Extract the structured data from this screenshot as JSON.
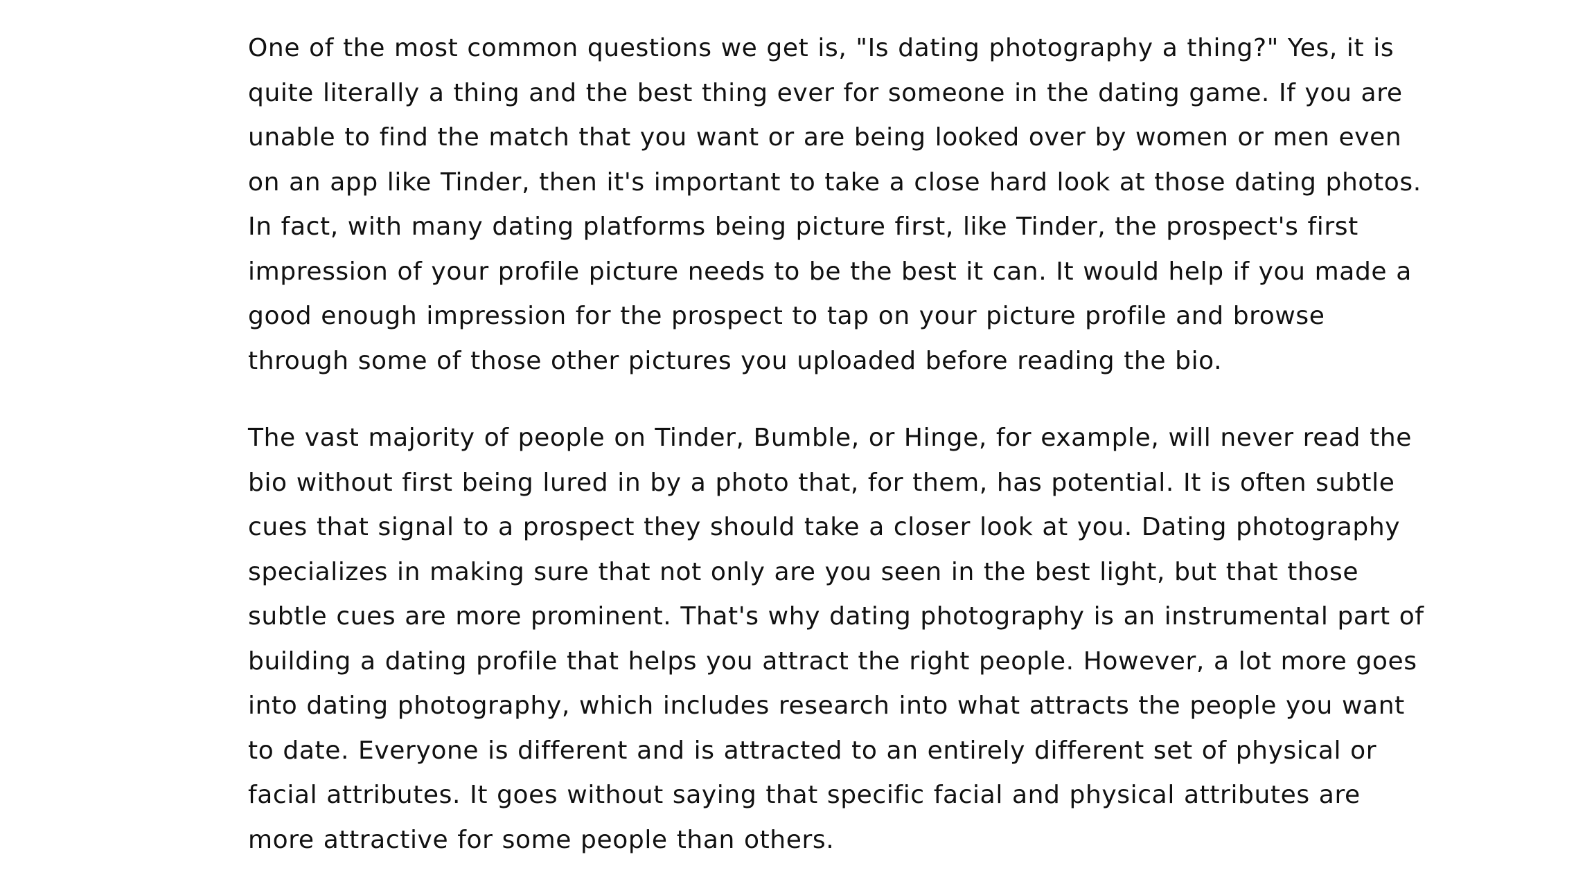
{
  "article": {
    "paragraphs": [
      {
        "lines": [
          "One of the most common questions we get is, \"Is dating photography a thing?\" Yes, it is",
          "quite literally a thing and the best thing ever for someone in the dating game. If you are",
          "unable to find the match that you want or are being looked over by women or men even",
          "on an app like Tinder, then it's important to take a close hard look at those dating photos.",
          "In fact, with many dating platforms being picture first, like Tinder, the prospect's first",
          "impression of your profile picture needs to be the best it can. It would help if you made a",
          "good enough impression for the prospect to tap on your picture profile and browse",
          "through some of those other pictures you uploaded before reading the bio."
        ]
      },
      {
        "lines": [
          "The vast majority of people on Tinder, Bumble, or Hinge, for example, will never read the",
          "bio without first being lured in by a photo that, for them, has potential. It is often subtle",
          "cues that signal to a prospect they should take a closer look at you. Dating photography",
          "specializes in making sure that not only are you seen in the best light, but that those",
          "subtle cues are more prominent. That's why dating photography is an instrumental part of",
          "building a dating profile that helps you attract the right people. However, a lot more goes",
          "into dating photography, which includes research into what attracts the people you want",
          "to date. Everyone is different and is attracted to an entirely different set of physical or",
          "facial attributes. It goes without saying that specific facial and physical attributes are",
          "more attractive for some people than others."
        ]
      }
    ]
  }
}
